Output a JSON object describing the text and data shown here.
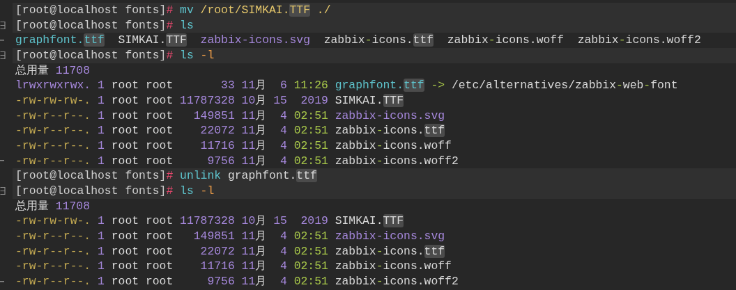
{
  "terminal": {
    "lines": [
      {
        "kind": "prompt",
        "fold_start": false,
        "fold_end": false,
        "segments": [
          {
            "text": "[root@localhost fonts]",
            "kind": "prompt"
          },
          {
            "text": "#",
            "kind": "hash"
          },
          {
            "text": " mv",
            "kind": "cmd"
          },
          {
            "text": " /root/SIMKAI.",
            "kind": "arg"
          },
          {
            "text": "TTF",
            "kind": "hl_arg"
          },
          {
            "text": " ./",
            "kind": "arg"
          }
        ]
      },
      {
        "kind": "prompt",
        "fold_start": true,
        "fold_end": false,
        "segments": [
          {
            "text": "[root@localhost fonts]",
            "kind": "prompt"
          },
          {
            "text": "#",
            "kind": "hash"
          },
          {
            "text": " ls",
            "kind": "cmd"
          }
        ]
      },
      {
        "kind": "output",
        "fold_start": false,
        "fold_end": true,
        "segments": [
          {
            "text": "graphfont.",
            "kind": "link"
          },
          {
            "text": "ttf",
            "kind": "hl_link"
          },
          {
            "text": "  SIMKAI.",
            "kind": "text"
          },
          {
            "text": "TTF",
            "kind": "hl_text"
          },
          {
            "text": "  zabbix-icons.svg",
            "kind": "num"
          },
          {
            "text": "  zabbix",
            "kind": "text"
          },
          {
            "text": "-",
            "kind": "green"
          },
          {
            "text": "icons.",
            "kind": "text"
          },
          {
            "text": "ttf",
            "kind": "hl_text"
          },
          {
            "text": "  zabbix",
            "kind": "text"
          },
          {
            "text": "-",
            "kind": "green"
          },
          {
            "text": "icons.woff  zabbix",
            "kind": "text"
          },
          {
            "text": "-",
            "kind": "green"
          },
          {
            "text": "icons.woff2",
            "kind": "text"
          }
        ]
      },
      {
        "kind": "prompt",
        "fold_start": true,
        "fold_end": false,
        "segments": [
          {
            "text": "[root@localhost fonts]",
            "kind": "prompt"
          },
          {
            "text": "#",
            "kind": "hash"
          },
          {
            "text": " ls",
            "kind": "cmd"
          },
          {
            "text": " -l",
            "kind": "flag"
          }
        ]
      },
      {
        "kind": "output",
        "fold_start": false,
        "fold_end": false,
        "segments": [
          {
            "text": "总用量 ",
            "kind": "text"
          },
          {
            "text": "11708",
            "kind": "num"
          }
        ]
      },
      {
        "kind": "output",
        "fold_start": false,
        "fold_end": false,
        "segments": [
          {
            "text": "lrwxrwxrwx.",
            "kind": "perm_link"
          },
          {
            "text": " 1",
            "kind": "num"
          },
          {
            "text": " root root ",
            "kind": "text"
          },
          {
            "text": "      33 11",
            "kind": "num"
          },
          {
            "text": "月",
            "kind": "text"
          },
          {
            "text": "  6",
            "kind": "num"
          },
          {
            "text": " 11:26 ",
            "kind": "green"
          },
          {
            "text": "graphfont.",
            "kind": "link"
          },
          {
            "text": "ttf",
            "kind": "hl_link"
          },
          {
            "text": " ->",
            "kind": "green"
          },
          {
            "text": " /etc/alternatives/zabbix",
            "kind": "text"
          },
          {
            "text": "-",
            "kind": "green"
          },
          {
            "text": "web",
            "kind": "text"
          },
          {
            "text": "-",
            "kind": "green"
          },
          {
            "text": "font",
            "kind": "text"
          }
        ]
      },
      {
        "kind": "output",
        "fold_start": false,
        "fold_end": false,
        "segments": [
          {
            "text": "-rw-rw-rw-.",
            "kind": "perm"
          },
          {
            "text": " 1",
            "kind": "num"
          },
          {
            "text": " root root ",
            "kind": "text"
          },
          {
            "text": "11787328 10",
            "kind": "num"
          },
          {
            "text": "月",
            "kind": "text"
          },
          {
            "text": " 15  2019",
            "kind": "num"
          },
          {
            "text": " SIMKAI.",
            "kind": "text"
          },
          {
            "text": "TTF",
            "kind": "hl_text"
          }
        ]
      },
      {
        "kind": "output",
        "fold_start": false,
        "fold_end": false,
        "segments": [
          {
            "text": "-rw-r--r--.",
            "kind": "perm"
          },
          {
            "text": " 1",
            "kind": "num"
          },
          {
            "text": " root root ",
            "kind": "text"
          },
          {
            "text": "  149851 11",
            "kind": "num"
          },
          {
            "text": "月",
            "kind": "text"
          },
          {
            "text": "  4",
            "kind": "num"
          },
          {
            "text": " 02:51",
            "kind": "green"
          },
          {
            "text": " zabbix-icons.svg",
            "kind": "num"
          }
        ]
      },
      {
        "kind": "output",
        "fold_start": false,
        "fold_end": false,
        "segments": [
          {
            "text": "-rw-r--r--.",
            "kind": "perm"
          },
          {
            "text": " 1",
            "kind": "num"
          },
          {
            "text": " root root ",
            "kind": "text"
          },
          {
            "text": "   22072 11",
            "kind": "num"
          },
          {
            "text": "月",
            "kind": "text"
          },
          {
            "text": "  4",
            "kind": "num"
          },
          {
            "text": " 02:51",
            "kind": "green"
          },
          {
            "text": " zabbix",
            "kind": "text"
          },
          {
            "text": "-",
            "kind": "green"
          },
          {
            "text": "icons.",
            "kind": "text"
          },
          {
            "text": "ttf",
            "kind": "hl_text"
          }
        ]
      },
      {
        "kind": "output",
        "fold_start": false,
        "fold_end": false,
        "segments": [
          {
            "text": "-rw-r--r--.",
            "kind": "perm"
          },
          {
            "text": " 1",
            "kind": "num"
          },
          {
            "text": " root root ",
            "kind": "text"
          },
          {
            "text": "   11716 11",
            "kind": "num"
          },
          {
            "text": "月",
            "kind": "text"
          },
          {
            "text": "  4",
            "kind": "num"
          },
          {
            "text": " 02:51",
            "kind": "green"
          },
          {
            "text": " zabbix",
            "kind": "text"
          },
          {
            "text": "-",
            "kind": "green"
          },
          {
            "text": "icons.woff",
            "kind": "text"
          }
        ]
      },
      {
        "kind": "output",
        "fold_start": false,
        "fold_end": true,
        "segments": [
          {
            "text": "-rw-r--r--.",
            "kind": "perm"
          },
          {
            "text": " 1",
            "kind": "num"
          },
          {
            "text": " root root ",
            "kind": "text"
          },
          {
            "text": "    9756 11",
            "kind": "num"
          },
          {
            "text": "月",
            "kind": "text"
          },
          {
            "text": "  4",
            "kind": "num"
          },
          {
            "text": " 02:51",
            "kind": "green"
          },
          {
            "text": " zabbix",
            "kind": "text"
          },
          {
            "text": "-",
            "kind": "green"
          },
          {
            "text": "icons.woff2",
            "kind": "text"
          }
        ]
      },
      {
        "kind": "prompt",
        "fold_start": false,
        "fold_end": false,
        "segments": [
          {
            "text": "[root@localhost fonts]",
            "kind": "prompt"
          },
          {
            "text": "#",
            "kind": "hash"
          },
          {
            "text": " unlink",
            "kind": "cmd"
          },
          {
            "text": " graphfont.",
            "kind": "text"
          },
          {
            "text": "ttf",
            "kind": "hl_text"
          }
        ]
      },
      {
        "kind": "prompt",
        "fold_start": true,
        "fold_end": false,
        "segments": [
          {
            "text": "[root@localhost fonts]",
            "kind": "prompt"
          },
          {
            "text": "#",
            "kind": "hash"
          },
          {
            "text": " ls",
            "kind": "cmd"
          },
          {
            "text": " -l",
            "kind": "flag"
          }
        ]
      },
      {
        "kind": "output",
        "fold_start": false,
        "fold_end": false,
        "segments": [
          {
            "text": "总用量 ",
            "kind": "text"
          },
          {
            "text": "11708",
            "kind": "num"
          }
        ]
      },
      {
        "kind": "output",
        "fold_start": false,
        "fold_end": false,
        "segments": [
          {
            "text": "-rw-rw-rw-.",
            "kind": "perm"
          },
          {
            "text": " 1",
            "kind": "num"
          },
          {
            "text": " root root ",
            "kind": "text"
          },
          {
            "text": "11787328 10",
            "kind": "num"
          },
          {
            "text": "月",
            "kind": "text"
          },
          {
            "text": " 15  2019",
            "kind": "num"
          },
          {
            "text": " SIMKAI.",
            "kind": "text"
          },
          {
            "text": "TTF",
            "kind": "hl_text"
          }
        ]
      },
      {
        "kind": "output",
        "fold_start": false,
        "fold_end": false,
        "segments": [
          {
            "text": "-rw-r--r--.",
            "kind": "perm"
          },
          {
            "text": " 1",
            "kind": "num"
          },
          {
            "text": " root root ",
            "kind": "text"
          },
          {
            "text": "  149851 11",
            "kind": "num"
          },
          {
            "text": "月",
            "kind": "text"
          },
          {
            "text": "  4",
            "kind": "num"
          },
          {
            "text": " 02:51",
            "kind": "green"
          },
          {
            "text": " zabbix-icons.svg",
            "kind": "num"
          }
        ]
      },
      {
        "kind": "output",
        "fold_start": false,
        "fold_end": false,
        "segments": [
          {
            "text": "-rw-r--r--.",
            "kind": "perm"
          },
          {
            "text": " 1",
            "kind": "num"
          },
          {
            "text": " root root ",
            "kind": "text"
          },
          {
            "text": "   22072 11",
            "kind": "num"
          },
          {
            "text": "月",
            "kind": "text"
          },
          {
            "text": "  4",
            "kind": "num"
          },
          {
            "text": " 02:51",
            "kind": "green"
          },
          {
            "text": " zabbix",
            "kind": "text"
          },
          {
            "text": "-",
            "kind": "green"
          },
          {
            "text": "icons.",
            "kind": "text"
          },
          {
            "text": "ttf",
            "kind": "hl_text"
          }
        ]
      },
      {
        "kind": "output",
        "fold_start": false,
        "fold_end": false,
        "segments": [
          {
            "text": "-rw-r--r--.",
            "kind": "perm"
          },
          {
            "text": " 1",
            "kind": "num"
          },
          {
            "text": " root root ",
            "kind": "text"
          },
          {
            "text": "   11716 11",
            "kind": "num"
          },
          {
            "text": "月",
            "kind": "text"
          },
          {
            "text": "  4",
            "kind": "num"
          },
          {
            "text": " 02:51",
            "kind": "green"
          },
          {
            "text": " zabbix",
            "kind": "text"
          },
          {
            "text": "-",
            "kind": "green"
          },
          {
            "text": "icons.woff",
            "kind": "text"
          }
        ]
      },
      {
        "kind": "output",
        "fold_start": false,
        "fold_end": true,
        "segments": [
          {
            "text": "-rw-r--r--.",
            "kind": "perm"
          },
          {
            "text": " 1",
            "kind": "num"
          },
          {
            "text": " root root ",
            "kind": "text"
          },
          {
            "text": "    9756 11",
            "kind": "num"
          },
          {
            "text": "月",
            "kind": "text"
          },
          {
            "text": "  4",
            "kind": "num"
          },
          {
            "text": " 02:51",
            "kind": "green"
          },
          {
            "text": " zabbix",
            "kind": "text"
          },
          {
            "text": "-",
            "kind": "green"
          },
          {
            "text": "icons.woff2",
            "kind": "text"
          }
        ]
      }
    ]
  }
}
